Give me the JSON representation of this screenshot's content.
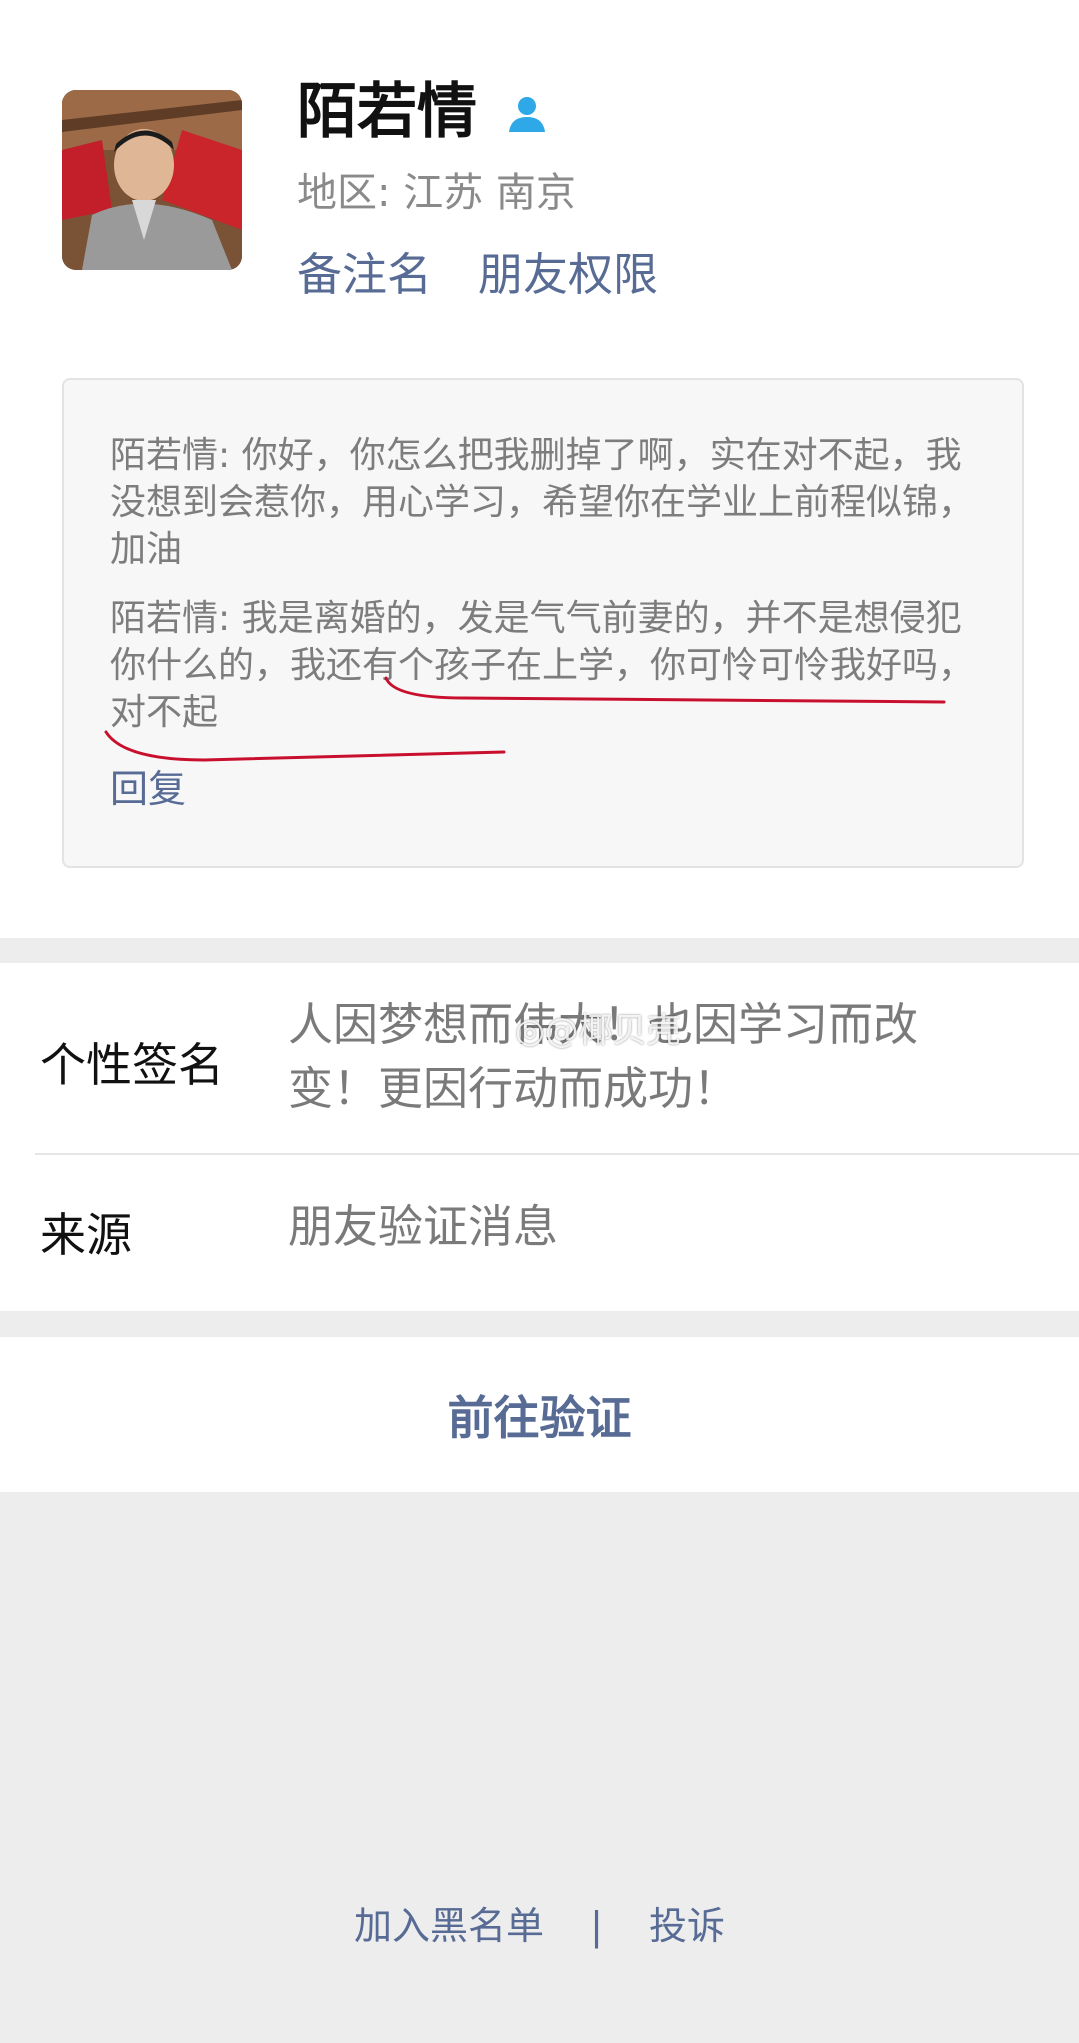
{
  "profile": {
    "name": "陌若情",
    "region": "地区: 江苏 南京",
    "remark_label": "备注名",
    "permission_label": "朋友权限"
  },
  "messages": [
    "陌若情: 你好，你怎么把我删掉了啊，实在对不起，我没想到会惹你，用心学习，希望你在学业上前程似锦，加油",
    "陌若情: 我是离婚的，发是气气前妻的，并不是想侵犯你什么的，我还有个孩子在上学，你可怜可怜我好吗，对不起"
  ],
  "reply_label": "回复",
  "signature": {
    "label": "个性签名",
    "value": "人因梦想而伟大！也因学习而改变！更因行动而成功！"
  },
  "source": {
    "label": "来源",
    "value": "朋友验证消息"
  },
  "watermark": "◎@椰贝壳",
  "action_label": "前往验证",
  "footer": {
    "blacklist_label": "加入黑名单",
    "separator": "|",
    "report_label": "投诉"
  },
  "colors": {
    "link": "#576b95",
    "annotation": "#c8102e",
    "verified_icon": "#2ea8e6"
  },
  "icons": {
    "verified": "person-icon"
  }
}
